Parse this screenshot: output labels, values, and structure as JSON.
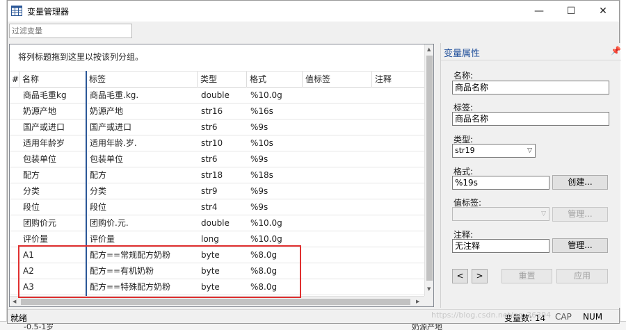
{
  "window": {
    "title": "变量管理器",
    "minimize": "—",
    "maximize": "☐",
    "close": "✕"
  },
  "filter": {
    "placeholder": "过滤变量"
  },
  "grid": {
    "group_hint": "将列标题拖到这里以按该列分组。",
    "columns": {
      "num": "#",
      "name": "名称",
      "label": "标签",
      "type": "类型",
      "format": "格式",
      "value_label": "值标签",
      "notes": "注释"
    },
    "rows": [
      {
        "name": "商品毛重kg",
        "label": "商品毛重.kg.",
        "type": "double",
        "format": "%10.0g"
      },
      {
        "name": "奶源产地",
        "label": "奶源产地",
        "type": "str16",
        "format": "%16s"
      },
      {
        "name": "国产或进口",
        "label": "国产或进口",
        "type": "str6",
        "format": "%9s"
      },
      {
        "name": "适用年龄岁",
        "label": "适用年龄.岁.",
        "type": "str10",
        "format": "%10s"
      },
      {
        "name": "包装单位",
        "label": "包装单位",
        "type": "str6",
        "format": "%9s"
      },
      {
        "name": "配方",
        "label": "配方",
        "type": "str18",
        "format": "%18s"
      },
      {
        "name": "分类",
        "label": "分类",
        "type": "str9",
        "format": "%9s"
      },
      {
        "name": "段位",
        "label": "段位",
        "type": "str4",
        "format": "%9s"
      },
      {
        "name": "团购价元",
        "label": "团购价.元.",
        "type": "double",
        "format": "%10.0g"
      },
      {
        "name": "评价量",
        "label": "评价量",
        "type": "long",
        "format": "%10.0g"
      },
      {
        "name": "A1",
        "label": "配方==常规配方奶粉",
        "type": "byte",
        "format": "%8.0g"
      },
      {
        "name": "A2",
        "label": "配方==有机奶粉",
        "type": "byte",
        "format": "%8.0g"
      },
      {
        "name": "A3",
        "label": "配方==特殊配方奶粉",
        "type": "byte",
        "format": "%8.0g"
      }
    ]
  },
  "props": {
    "title": "变量属性",
    "name_label": "名称:",
    "name_value": "商品名称",
    "label_label": "标签:",
    "label_value": "商品名称",
    "type_label": "类型:",
    "type_value": "str19",
    "format_label": "格式:",
    "format_value": "%19s",
    "create_button": "创建...",
    "value_label_label": "值标签:",
    "value_label_manage": "管理...",
    "notes_label": "注释:",
    "notes_value": "无注释",
    "notes_manage": "管理...",
    "prev": "<",
    "next": ">",
    "reset": "重置",
    "apply": "应用"
  },
  "status": {
    "ready": "就绪",
    "var_count": "变量数: 14",
    "cap": "CAP",
    "num": "NUM"
  },
  "background": {
    "bottom_left": "-0.5-1岁",
    "bottom_mid": "奶源产地"
  },
  "watermark": "https://blog.csdn.net/qq_36394"
}
